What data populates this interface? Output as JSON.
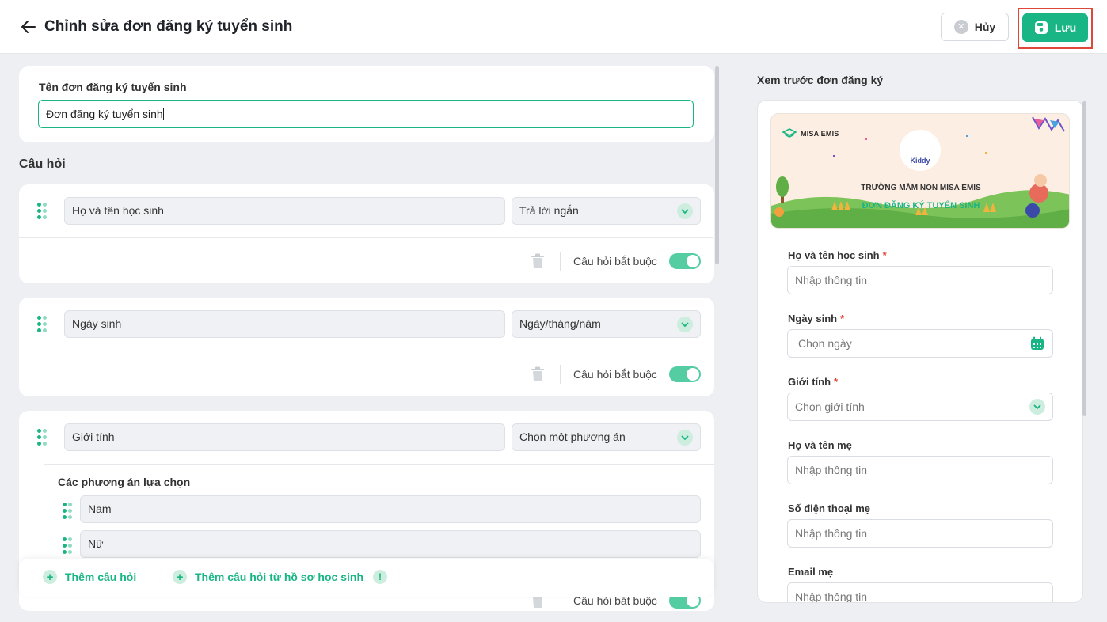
{
  "header": {
    "title": "Chỉnh sửa đơn đăng ký tuyển sinh",
    "cancel_label": "Hủy",
    "save_label": "Lưu"
  },
  "form_name": {
    "label": "Tên đơn đăng ký tuyển sinh",
    "value": "Đơn đăng ký tuyển sinh"
  },
  "questions_title": "Câu hỏi",
  "questions": [
    {
      "name": "Họ và tên học sinh",
      "type": "Trả lời ngắn",
      "required_label": "Câu hỏi bắt buộc",
      "required": true
    },
    {
      "name": "Ngày sinh",
      "type": "Ngày/tháng/năm",
      "required_label": "Câu hỏi bắt buộc",
      "required": true
    },
    {
      "name": "Giới tính",
      "type": "Chọn một phương án",
      "options_title": "Các phương án lựa chọn",
      "options": [
        "Nam",
        "Nữ"
      ],
      "required_label": "Câu hỏi bắt buộc",
      "required": true
    }
  ],
  "add_bar": {
    "add_question": "Thêm câu hỏi",
    "add_from_profile": "Thêm câu hỏi từ hồ sơ học sinh"
  },
  "preview": {
    "title": "Xem trước đơn đăng ký",
    "banner": {
      "brand": "MISA EMIS",
      "logo_text": "Kiddy",
      "school": "TRƯỜNG MẦM NON MISA EMIS",
      "form_title": "ĐƠN ĐĂNG KÝ TUYỂN SINH"
    },
    "fields": [
      {
        "label": "Họ và tên học sinh",
        "required": "*",
        "placeholder": "Nhập thông tin"
      },
      {
        "label": "Ngày sinh",
        "required": "*",
        "placeholder": "Chọn ngày"
      },
      {
        "label": "Giới tính",
        "required": "*",
        "placeholder": "Chọn giới tính"
      },
      {
        "label": "Họ và tên mẹ",
        "placeholder": "Nhập thông tin"
      },
      {
        "label": "Số điện thoại mẹ",
        "placeholder": "Nhập thông tin"
      },
      {
        "label": "Email mẹ",
        "placeholder": "Nhập thông tin"
      }
    ]
  },
  "colors": {
    "accent": "#1ab584",
    "highlight_border": "#e0473b",
    "required_star": "#e0473b"
  }
}
